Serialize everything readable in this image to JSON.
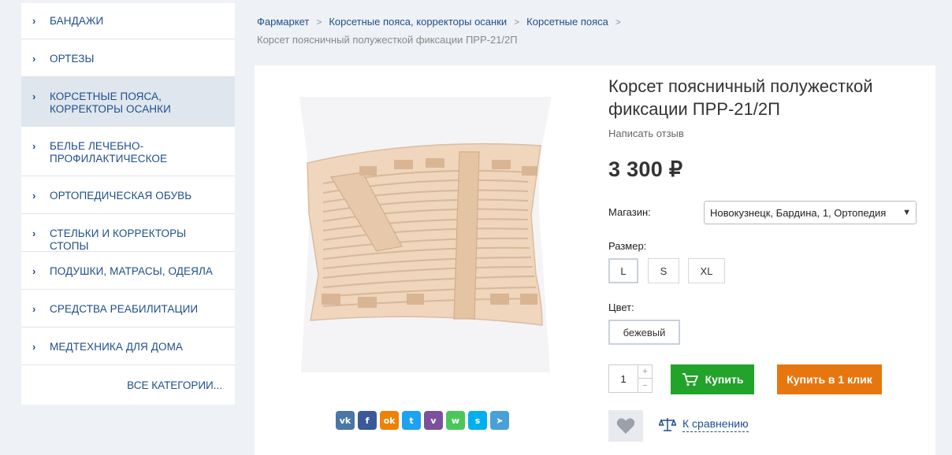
{
  "sidebar": {
    "items": [
      {
        "label": "БАНДАЖИ"
      },
      {
        "label": "ОРТЕЗЫ"
      },
      {
        "label": "КОРСЕТНЫЕ ПОЯСА, КОРРЕКТОРЫ ОСАНКИ"
      },
      {
        "label": "БЕЛЬЕ ЛЕЧЕБНО-ПРОФИЛАКТИЧЕСКОЕ"
      },
      {
        "label": "ОРТОПЕДИЧЕСКАЯ ОБУВЬ"
      },
      {
        "label": "СТЕЛЬКИ И КОРРЕКТОРЫ СТОПЫ"
      },
      {
        "label": "ПОДУШКИ, МАТРАСЫ, ОДЕЯЛА"
      },
      {
        "label": "СРЕДСТВА РЕАБИЛИТАЦИИ"
      },
      {
        "label": "МЕДТЕХНИКА ДЛЯ ДОМА"
      }
    ],
    "active_index": 2,
    "all_label": "ВСЕ КАТЕГОРИИ..."
  },
  "breadcrumb": {
    "items": [
      "Фармаркет",
      "Корсетные пояса, корректоры осанки",
      "Корсетные пояса"
    ],
    "current": "Корсет поясничный полужесткой фиксации ПРР-21/2П"
  },
  "product": {
    "title": "Корсет поясничный полужесткой фиксации ПРР-21/2П",
    "review_link": "Написать отзыв",
    "price": "3 300 ₽",
    "store_label": "Магазин:",
    "store_value": "Новокузнецк, Бардина, 1, Ортопедия",
    "size_label": "Размер:",
    "sizes": [
      "L",
      "S",
      "XL"
    ],
    "selected_size": "L",
    "color_label": "Цвет:",
    "colors": [
      "бежевый"
    ],
    "quantity": "1",
    "qty_plus": "+",
    "qty_minus": "−",
    "buy_label": "Купить",
    "one_click_label": "Купить в 1 клик",
    "compare_label": "К сравнению"
  },
  "share": [
    {
      "name": "vk",
      "glyph": "vk",
      "color": "#4a76a8"
    },
    {
      "name": "facebook",
      "glyph": "f",
      "color": "#3b5998"
    },
    {
      "name": "odnoklassniki",
      "glyph": "ok",
      "color": "#ee8208"
    },
    {
      "name": "twitter",
      "glyph": "t",
      "color": "#1da1f2"
    },
    {
      "name": "viber",
      "glyph": "v",
      "color": "#7b519d"
    },
    {
      "name": "whatsapp",
      "glyph": "w",
      "color": "#4bc75a"
    },
    {
      "name": "skype",
      "glyph": "s",
      "color": "#00aff0"
    },
    {
      "name": "telegram",
      "glyph": "➤",
      "color": "#48a0d8"
    }
  ],
  "colors": {
    "link": "#1f4e8c",
    "buy": "#22a32a",
    "one_click": "#e8760f",
    "product_beige": "#edd3b8"
  }
}
